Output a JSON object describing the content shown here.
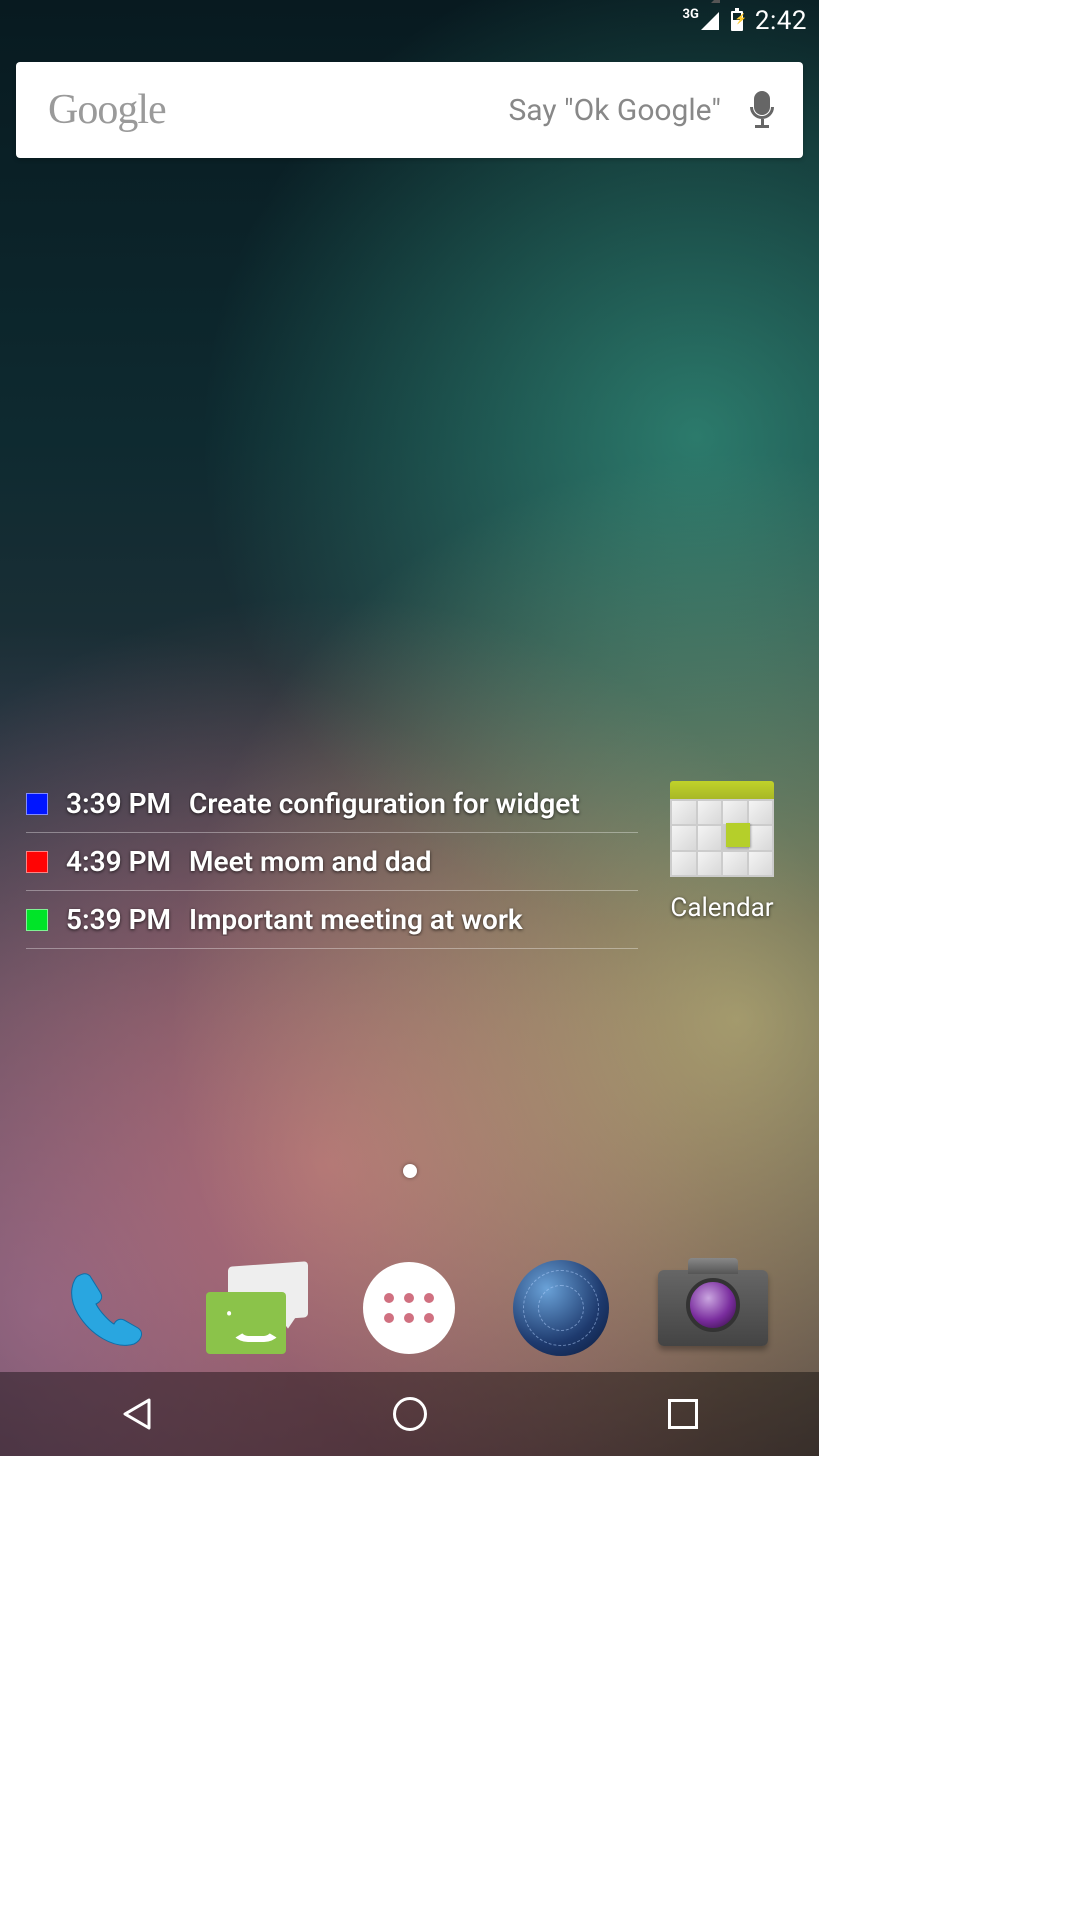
{
  "status": {
    "network_label": "3G",
    "time": "2:42"
  },
  "search": {
    "brand": "Google",
    "hint": "Say \"Ok Google\""
  },
  "calendar_widget": {
    "events": [
      {
        "color": "#0015ff",
        "time": "3:39 PM",
        "title": "Create configuration for widget"
      },
      {
        "color": "#ff0404",
        "time": "4:39 PM",
        "title": "Meet mom and dad"
      },
      {
        "color": "#00e428",
        "time": "5:39 PM",
        "title": "Important meeting at work"
      }
    ],
    "app_label": "Calendar"
  },
  "dock": {
    "phone": "Phone",
    "messaging": "Messaging",
    "apps": "Apps",
    "browser": "Browser",
    "camera": "Camera"
  },
  "nav": {
    "back": "Back",
    "home": "Home",
    "recent": "Recent"
  }
}
